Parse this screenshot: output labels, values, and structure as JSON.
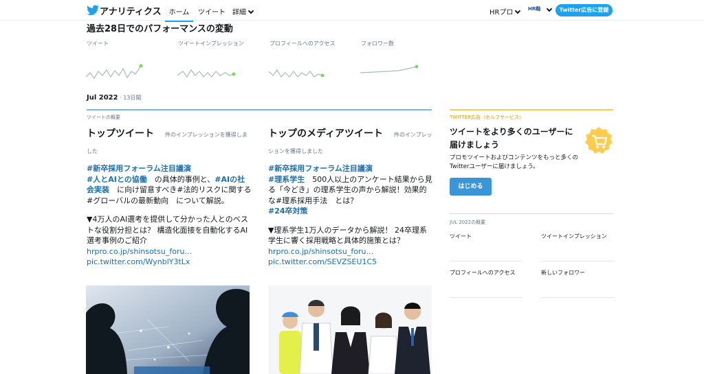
{
  "topbar": {
    "app_title": "アナリティクス",
    "nav": [
      "ホーム",
      "ツイート",
      "詳細"
    ],
    "account_name": "HRプロ",
    "avatar_text": "HR㍾",
    "promo_button": "Twitter広告に登録"
  },
  "performance": {
    "title": "過去28日でのパフォーマンスの変動",
    "metrics": [
      {
        "label": "ツイート",
        "icon": "sparkline-tweets"
      },
      {
        "label": "ツイートインプレッション",
        "icon": "sparkline-impressions"
      },
      {
        "label": "プロフィールへのアクセス",
        "icon": "sparkline-profile-visits"
      },
      {
        "label": "フォロワー数",
        "icon": "sparkline-followers"
      }
    ]
  },
  "period": {
    "month": "Jul 2022",
    "days": " · 13日間"
  },
  "overview_label": "ツイートの概要",
  "top_tweet": {
    "heading": "トップツイート",
    "impressions": "件のインプレッションを獲得しました",
    "tags1": "#新卒採用フォーラム注目議演",
    "tags2": "#人とAIとの協働",
    "text1": "　の具体的事例と、",
    "tags3": "#AIの社会実装",
    "text2": "　に向け留意すべき#法的リスクに関する#グローバルの最新動向　について解説。",
    "text3": "▼4万人のAI選考を提供して分かった人とのベストな役割分担とは？ 構造化面接を自動化するAI選考事例のご紹介",
    "link1": "hrpro.co.jp/shinsotsu_foru…",
    "link2": "pic.twitter.com/WynblY3tLx"
  },
  "top_media": {
    "heading": "トップのメディアツイート",
    "impressions": "件のインプレッションを獲得しました",
    "tags1": "#新卒採用フォーラム注目議演",
    "tags2": "#理系学生",
    "text1": "　500人以上のアンケート結果から見る「今どき」の理系学生の声から解説！効果的な#理系採用手法　とは？",
    "tags3": "#24卒対策",
    "text2": "▼理系学生1万人のデータから解説！ 24卒理系学生に響く採用戦略と具体的施策とは？",
    "link1": "hrpro.co.jp/shinsotsu_foru…",
    "link2": "pic.twitter.com/SEVZSEU1C5"
  },
  "sidebar": {
    "label": "TWITTER広告（セルフサービス）",
    "headline": "ツイートをより多くのユーザーに届けましょう",
    "body": "プロモツイートおよびコンテンツをもっと多くのTwitterユーザーに届けましょう。",
    "button": "はじめる",
    "summary_label": "JUL 2022の概要",
    "summary_items": [
      "ツイート",
      "ツイートインプレッション",
      "プロフィールへのアクセス",
      "新しいフォロワー"
    ]
  },
  "colors": {
    "accent": "#1da1f2",
    "link": "#1b6fb1",
    "ad_yellow": "#ffcc4d"
  }
}
